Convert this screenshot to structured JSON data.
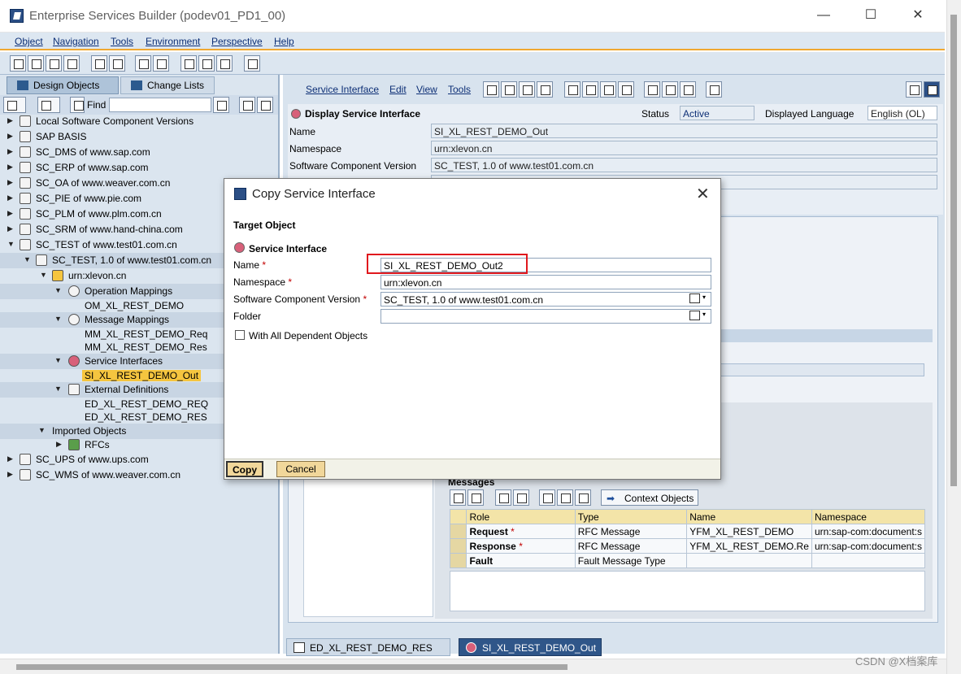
{
  "window": {
    "title": "Enterprise Services Builder (podev01_PD1_00)",
    "controls": [
      "—",
      "☐",
      "✕"
    ]
  },
  "menu": [
    "Object",
    "Navigation",
    "Tools",
    "Environment",
    "Perspective",
    "Help"
  ],
  "left": {
    "tabs": [
      "Design Objects",
      "Change Lists"
    ],
    "find_label": "Find",
    "tree": [
      "Local Software Component Versions",
      "SAP BASIS",
      "SC_DMS of www.sap.com",
      "SC_ERP of www.sap.com",
      "SC_OA of www.weaver.com.cn",
      "SC_PIE of www.pie.com",
      "SC_PLM of www.plm.com.cn",
      "SC_SRM of www.hand-china.com",
      "SC_TEST of www.test01.com.cn",
      "SC_TEST, 1.0 of www.test01.com.cn",
      "urn:xlevon.cn",
      "Operation Mappings",
      "OM_XL_REST_DEMO",
      "Message Mappings",
      "MM_XL_REST_DEMO_Req",
      "MM_XL_REST_DEMO_Res",
      "Service Interfaces",
      "SI_XL_REST_DEMO_Out",
      "External Definitions",
      "ED_XL_REST_DEMO_REQ",
      "ED_XL_REST_DEMO_RES",
      "Imported Objects",
      "RFCs",
      "SC_UPS of www.ups.com",
      "SC_WMS of www.weaver.com.cn"
    ]
  },
  "right": {
    "menu": [
      "Service Interface",
      "Edit",
      "View",
      "Tools"
    ],
    "heading": "Display Service Interface",
    "status_label": "Status",
    "status_value": "Active",
    "lang_label": "Displayed Language",
    "lang_value": "English (OL)",
    "fields": [
      {
        "label": "Name",
        "value": "SI_XL_REST_DEMO_Out"
      },
      {
        "label": "Namespace",
        "value": "urn:xlevon.cn"
      },
      {
        "label": "Software Component Version",
        "value": "SC_TEST, 1.0 of www.test01.com.cn"
      }
    ],
    "messages": {
      "title": "Messages",
      "context_button": "Context Objects",
      "columns": [
        "Role",
        "Type",
        "Name",
        "Namespace"
      ],
      "rows": [
        {
          "role": "Request",
          "req": "*",
          "type": "RFC Message",
          "name": "YFM_XL_REST_DEMO",
          "ns": "urn:sap-com:document:s"
        },
        {
          "role": "Response",
          "req": "*",
          "type": "RFC Message",
          "name": "YFM_XL_REST_DEMO.Re",
          "ns": "urn:sap-com:document:s"
        },
        {
          "role": "Fault",
          "req": "",
          "type": "Fault Message Type",
          "name": "",
          "ns": ""
        }
      ]
    },
    "bottom_tabs": [
      "ED_XL_REST_DEMO_RES",
      "SI_XL_REST_DEMO_Out"
    ]
  },
  "dialog": {
    "title": "Copy Service Interface",
    "section": "Target Object",
    "subsection": "Service Interface",
    "req_mark": "*",
    "fields": {
      "name_label": "Name",
      "name_value": "SI_XL_REST_DEMO_Out2",
      "ns_label": "Namespace",
      "ns_value": "urn:xlevon.cn",
      "swcv_label": "Software Component Version",
      "swcv_value": "SC_TEST, 1.0 of www.test01.com.cn",
      "folder_label": "Folder",
      "folder_value": ""
    },
    "checkbox_label": "With All Dependent Objects",
    "buttons": {
      "copy": "Copy",
      "cancel": "Cancel"
    }
  },
  "watermark": "CSDN @X档案库"
}
